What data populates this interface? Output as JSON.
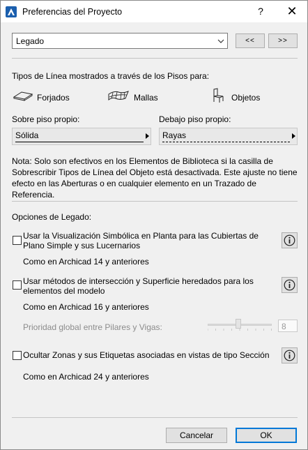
{
  "window": {
    "title": "Preferencias del Proyecto",
    "help_label": "?",
    "close_label": "✕"
  },
  "preset": {
    "selected": "Legado",
    "prev_label": "<<",
    "next_label": ">>"
  },
  "line_types": {
    "heading": "Tipos de Línea mostrados a través de los Pisos para:",
    "items": [
      {
        "label": "Forjados",
        "icon": "slab-icon"
      },
      {
        "label": "Mallas",
        "icon": "mesh-icon"
      },
      {
        "label": "Objetos",
        "icon": "chair-icon"
      }
    ],
    "own_floor_label": "Sobre piso propio:",
    "own_floor_value": "Sólida",
    "below_floor_label": "Debajo piso propio:",
    "below_floor_value": "Rayas"
  },
  "note": "Nota: Solo son efectivos en los Elementos de Biblioteca si la casilla de Sobrescribir Tipos de Línea del Objeto está desactivada. Este ajuste no tiene efecto en las Aberturas o en cualquier elemento en un Trazado de Referencia.",
  "legacy": {
    "heading": "Opciones de Legado:",
    "options": [
      {
        "label": "Usar la Visualización Simbólica en Planta para las Cubiertas de Plano Simple y sus Lucernarios",
        "checked": false,
        "caption": "Como en Archicad 14 y anteriores"
      },
      {
        "label": "Usar métodos de intersección y Superficie heredados para los elementos del modelo",
        "checked": false,
        "caption": "Como en Archicad 16 y anteriores"
      },
      {
        "label": "Ocultar Zonas y sus Etiquetas asociadas en vistas de tipo Sección",
        "checked": false,
        "caption": "Como en Archicad 24 y anteriores"
      }
    ],
    "priority_label": "Prioridad global entre Pilares y Vigas:",
    "priority_value": "8"
  },
  "footer": {
    "cancel_label": "Cancelar",
    "ok_label": "OK"
  },
  "colors": {
    "accent": "#0078d7",
    "window_bg": "#f0f0f0"
  }
}
